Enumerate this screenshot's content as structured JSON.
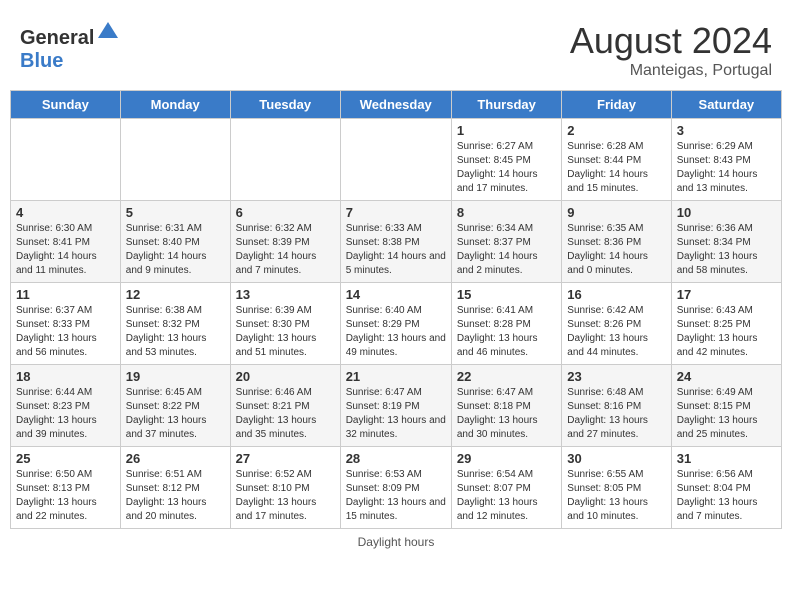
{
  "header": {
    "logo_general": "General",
    "logo_blue": "Blue",
    "month_year": "August 2024",
    "location": "Manteigas, Portugal"
  },
  "days_of_week": [
    "Sunday",
    "Monday",
    "Tuesday",
    "Wednesday",
    "Thursday",
    "Friday",
    "Saturday"
  ],
  "weeks": [
    [
      {
        "day": "",
        "info": ""
      },
      {
        "day": "",
        "info": ""
      },
      {
        "day": "",
        "info": ""
      },
      {
        "day": "",
        "info": ""
      },
      {
        "day": "1",
        "info": "Sunrise: 6:27 AM\nSunset: 8:45 PM\nDaylight: 14 hours and 17 minutes."
      },
      {
        "day": "2",
        "info": "Sunrise: 6:28 AM\nSunset: 8:44 PM\nDaylight: 14 hours and 15 minutes."
      },
      {
        "day": "3",
        "info": "Sunrise: 6:29 AM\nSunset: 8:43 PM\nDaylight: 14 hours and 13 minutes."
      }
    ],
    [
      {
        "day": "4",
        "info": "Sunrise: 6:30 AM\nSunset: 8:41 PM\nDaylight: 14 hours and 11 minutes."
      },
      {
        "day": "5",
        "info": "Sunrise: 6:31 AM\nSunset: 8:40 PM\nDaylight: 14 hours and 9 minutes."
      },
      {
        "day": "6",
        "info": "Sunrise: 6:32 AM\nSunset: 8:39 PM\nDaylight: 14 hours and 7 minutes."
      },
      {
        "day": "7",
        "info": "Sunrise: 6:33 AM\nSunset: 8:38 PM\nDaylight: 14 hours and 5 minutes."
      },
      {
        "day": "8",
        "info": "Sunrise: 6:34 AM\nSunset: 8:37 PM\nDaylight: 14 hours and 2 minutes."
      },
      {
        "day": "9",
        "info": "Sunrise: 6:35 AM\nSunset: 8:36 PM\nDaylight: 14 hours and 0 minutes."
      },
      {
        "day": "10",
        "info": "Sunrise: 6:36 AM\nSunset: 8:34 PM\nDaylight: 13 hours and 58 minutes."
      }
    ],
    [
      {
        "day": "11",
        "info": "Sunrise: 6:37 AM\nSunset: 8:33 PM\nDaylight: 13 hours and 56 minutes."
      },
      {
        "day": "12",
        "info": "Sunrise: 6:38 AM\nSunset: 8:32 PM\nDaylight: 13 hours and 53 minutes."
      },
      {
        "day": "13",
        "info": "Sunrise: 6:39 AM\nSunset: 8:30 PM\nDaylight: 13 hours and 51 minutes."
      },
      {
        "day": "14",
        "info": "Sunrise: 6:40 AM\nSunset: 8:29 PM\nDaylight: 13 hours and 49 minutes."
      },
      {
        "day": "15",
        "info": "Sunrise: 6:41 AM\nSunset: 8:28 PM\nDaylight: 13 hours and 46 minutes."
      },
      {
        "day": "16",
        "info": "Sunrise: 6:42 AM\nSunset: 8:26 PM\nDaylight: 13 hours and 44 minutes."
      },
      {
        "day": "17",
        "info": "Sunrise: 6:43 AM\nSunset: 8:25 PM\nDaylight: 13 hours and 42 minutes."
      }
    ],
    [
      {
        "day": "18",
        "info": "Sunrise: 6:44 AM\nSunset: 8:23 PM\nDaylight: 13 hours and 39 minutes."
      },
      {
        "day": "19",
        "info": "Sunrise: 6:45 AM\nSunset: 8:22 PM\nDaylight: 13 hours and 37 minutes."
      },
      {
        "day": "20",
        "info": "Sunrise: 6:46 AM\nSunset: 8:21 PM\nDaylight: 13 hours and 35 minutes."
      },
      {
        "day": "21",
        "info": "Sunrise: 6:47 AM\nSunset: 8:19 PM\nDaylight: 13 hours and 32 minutes."
      },
      {
        "day": "22",
        "info": "Sunrise: 6:47 AM\nSunset: 8:18 PM\nDaylight: 13 hours and 30 minutes."
      },
      {
        "day": "23",
        "info": "Sunrise: 6:48 AM\nSunset: 8:16 PM\nDaylight: 13 hours and 27 minutes."
      },
      {
        "day": "24",
        "info": "Sunrise: 6:49 AM\nSunset: 8:15 PM\nDaylight: 13 hours and 25 minutes."
      }
    ],
    [
      {
        "day": "25",
        "info": "Sunrise: 6:50 AM\nSunset: 8:13 PM\nDaylight: 13 hours and 22 minutes."
      },
      {
        "day": "26",
        "info": "Sunrise: 6:51 AM\nSunset: 8:12 PM\nDaylight: 13 hours and 20 minutes."
      },
      {
        "day": "27",
        "info": "Sunrise: 6:52 AM\nSunset: 8:10 PM\nDaylight: 13 hours and 17 minutes."
      },
      {
        "day": "28",
        "info": "Sunrise: 6:53 AM\nSunset: 8:09 PM\nDaylight: 13 hours and 15 minutes."
      },
      {
        "day": "29",
        "info": "Sunrise: 6:54 AM\nSunset: 8:07 PM\nDaylight: 13 hours and 12 minutes."
      },
      {
        "day": "30",
        "info": "Sunrise: 6:55 AM\nSunset: 8:05 PM\nDaylight: 13 hours and 10 minutes."
      },
      {
        "day": "31",
        "info": "Sunrise: 6:56 AM\nSunset: 8:04 PM\nDaylight: 13 hours and 7 minutes."
      }
    ]
  ],
  "footer": "Daylight hours"
}
